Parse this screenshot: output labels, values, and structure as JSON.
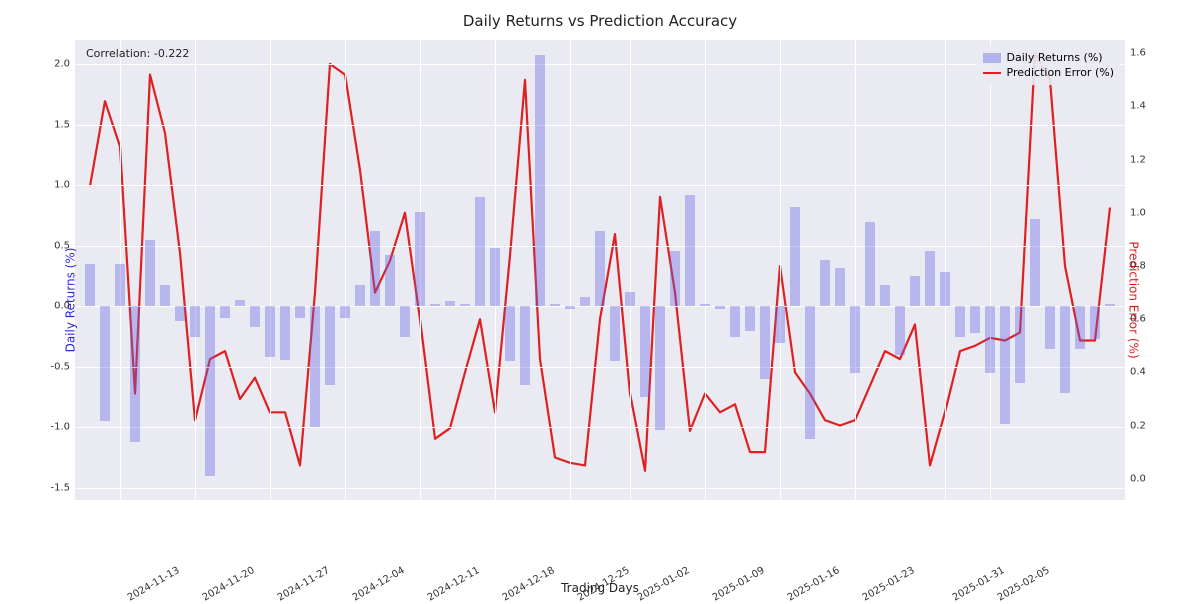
{
  "chart_data": {
    "type": "bar+line",
    "title": "Daily Returns vs Prediction Accuracy",
    "xlabel": "Trading Days",
    "ylabel_left": "Daily Returns (%)",
    "ylabel_right": "Prediction Error (%)",
    "annotation": "Correlation: -0.222",
    "legend": {
      "bar": "Daily Returns (%)",
      "line": "Prediction Error (%)"
    },
    "ylim_left": [
      -1.6,
      2.2
    ],
    "ylim_right": [
      -0.08,
      1.65
    ],
    "yticks_left": [
      -1.5,
      -1.0,
      -0.5,
      0.0,
      0.5,
      1.0,
      1.5,
      2.0
    ],
    "yticks_right": [
      0.0,
      0.2,
      0.4,
      0.6,
      0.8,
      1.0,
      1.2,
      1.4,
      1.6
    ],
    "xticks": [
      {
        "i": 2,
        "label": "2024-11-13"
      },
      {
        "i": 7,
        "label": "2024-11-20"
      },
      {
        "i": 12,
        "label": "2024-11-27"
      },
      {
        "i": 17,
        "label": "2024-12-04"
      },
      {
        "i": 22,
        "label": "2024-12-11"
      },
      {
        "i": 27,
        "label": "2024-12-18"
      },
      {
        "i": 32,
        "label": "2024-12-25"
      },
      {
        "i": 36,
        "label": "2025-01-02"
      },
      {
        "i": 41,
        "label": "2025-01-09"
      },
      {
        "i": 46,
        "label": "2025-01-16"
      },
      {
        "i": 51,
        "label": "2025-01-23"
      },
      {
        "i": 57,
        "label": "2025-01-31"
      },
      {
        "i": 60,
        "label": "2025-02-05"
      }
    ],
    "series": [
      {
        "name": "Daily Returns (%)",
        "kind": "bar",
        "values": [
          0.35,
          -0.95,
          0.35,
          -1.12,
          0.55,
          0.18,
          -0.12,
          -0.25,
          -1.4,
          -0.1,
          0.05,
          -0.17,
          -0.42,
          -0.44,
          -0.1,
          -1.0,
          -0.65,
          -0.1,
          0.18,
          0.62,
          0.42,
          -0.25,
          0.78,
          0.02,
          0.04,
          0.02,
          0.9,
          0.48,
          -0.45,
          -0.65,
          2.08,
          0.02,
          -0.02,
          0.08,
          0.62,
          -0.45,
          0.12,
          -0.75,
          -1.02,
          0.46,
          0.92,
          0.02,
          -0.02,
          -0.25,
          -0.2,
          -0.6,
          -0.3,
          0.82,
          -1.1,
          0.38,
          0.32,
          -0.55,
          0.7,
          0.18,
          -0.4,
          0.25,
          0.46,
          0.28,
          -0.25,
          -0.22,
          -0.55,
          -0.97,
          -0.63,
          0.72,
          -0.35,
          -0.72,
          -0.35,
          -0.27,
          0.02
        ]
      },
      {
        "name": "Prediction Error (%)",
        "kind": "line",
        "values": [
          1.1,
          1.42,
          1.25,
          0.32,
          1.52,
          1.3,
          0.85,
          0.22,
          0.45,
          0.48,
          0.3,
          0.38,
          0.25,
          0.25,
          0.05,
          0.7,
          1.56,
          1.52,
          1.16,
          0.7,
          0.82,
          1.0,
          0.6,
          0.15,
          0.19,
          0.4,
          0.6,
          0.25,
          0.84,
          1.5,
          0.45,
          0.08,
          0.06,
          0.05,
          0.6,
          0.92,
          0.32,
          0.03,
          1.06,
          0.7,
          0.18,
          0.32,
          0.25,
          0.28,
          0.1,
          0.1,
          0.8,
          0.4,
          0.32,
          0.22,
          0.2,
          0.22,
          0.35,
          0.48,
          0.45,
          0.58,
          0.05,
          0.25,
          0.48,
          0.5,
          0.53,
          0.52,
          0.55,
          1.6,
          1.5,
          0.8,
          0.52,
          0.52,
          1.02
        ]
      }
    ]
  }
}
